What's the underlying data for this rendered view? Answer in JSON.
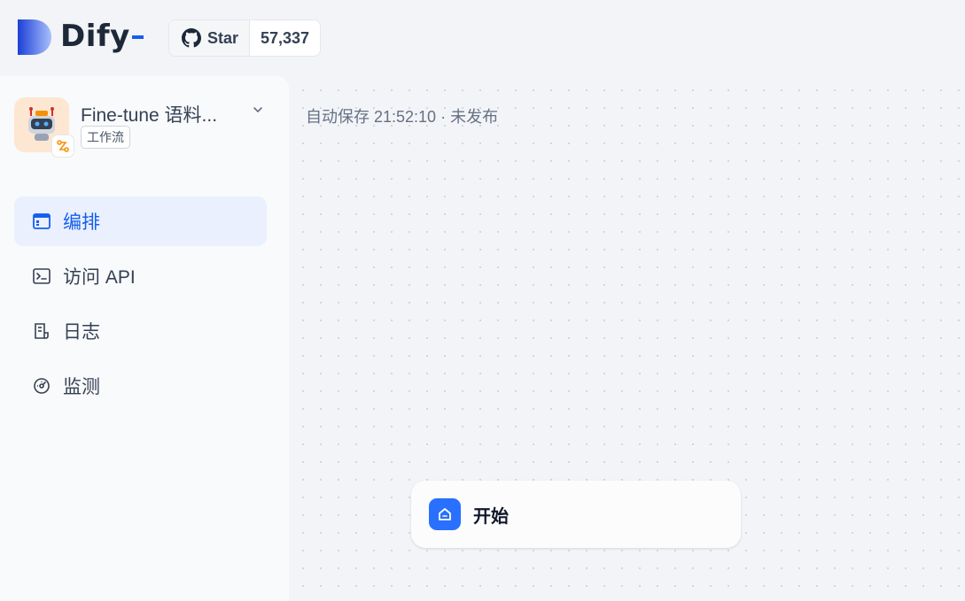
{
  "brand": {
    "name": "Dify",
    "accent": "#155eef"
  },
  "github": {
    "icon": "github-icon",
    "star_label": "Star",
    "count": "57,337"
  },
  "app": {
    "name": "Fine-tune 语料...",
    "type": "工作流",
    "icon": "robot-icon",
    "mode_icon": "workflow-icon",
    "chevron": "chevron-down-icon"
  },
  "nav": {
    "items": [
      {
        "label": "编排",
        "icon": "orchestrate-icon",
        "active": true
      },
      {
        "label": "访问 API",
        "icon": "terminal-icon",
        "active": false
      },
      {
        "label": "日志",
        "icon": "log-icon",
        "active": false
      },
      {
        "label": "监测",
        "icon": "gauge-icon",
        "active": false
      }
    ]
  },
  "canvas": {
    "save_status": "自动保存 21:52:10 · 未发布",
    "nodes": [
      {
        "title": "开始",
        "icon": "home-icon",
        "color": "#2970ff"
      }
    ]
  }
}
